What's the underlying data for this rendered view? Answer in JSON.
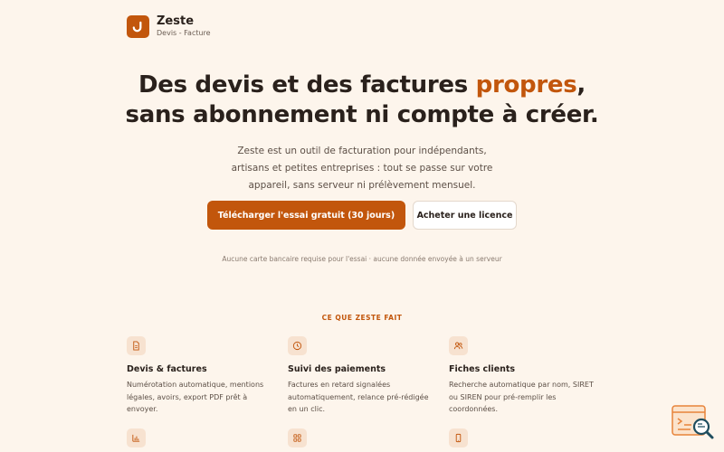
{
  "brand": {
    "name": "Zeste",
    "tagline": "Devis - Facture"
  },
  "hero": {
    "title_line1_pre": "Des devis et des factures ",
    "title_accent": "propres",
    "title_line1_post": ",",
    "title_line2": "sans abonnement ni compte à créer.",
    "description": "Zeste est un outil de facturation pour indépendants, artisans et petites entreprises : tout se passe sur votre appareil, sans serveur ni prélèvement mensuel."
  },
  "cta": {
    "primary_label": "Télécharger l'essai gratuit (30 jours)",
    "secondary_label": "Acheter une licence"
  },
  "fine_print": "Aucune carte bancaire requise pour l'essai · aucune donnée envoyée à un serveur",
  "features_section": {
    "label": "CE QUE ZESTE FAIT",
    "items": [
      {
        "icon": "document-icon",
        "title": "Devis & factures",
        "text": "Numérotation automatique, mentions légales, avoirs, export PDF prêt à envoyer."
      },
      {
        "icon": "clock-icon",
        "title": "Suivi des paiements",
        "text": "Factures en retard signalées automatiquement, relance pré-rédigée en un clic."
      },
      {
        "icon": "users-icon",
        "title": "Fiches clients",
        "text": "Recherche automatique par nom, SIRET ou SIREN pour pré-remplir les coordonnées."
      },
      {
        "icon": "bar-chart-icon"
      },
      {
        "icon": "grid-icon"
      },
      {
        "icon": "phone-icon"
      }
    ]
  },
  "colors": {
    "accent": "#c2560c",
    "background": "#fdf5ec",
    "text": "#2a211c"
  }
}
